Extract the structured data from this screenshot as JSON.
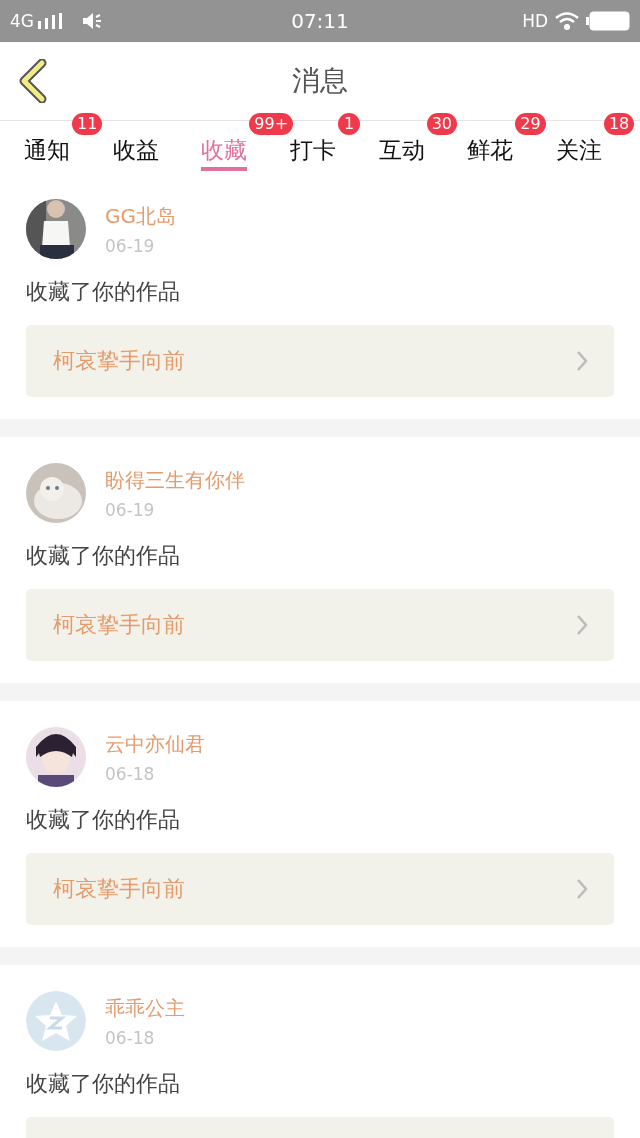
{
  "status_bar": {
    "network": "4G",
    "time": "07:11",
    "hd": "HD"
  },
  "header": {
    "title": "消息"
  },
  "tabs": [
    {
      "label": "通知",
      "badge": "11",
      "selected": false
    },
    {
      "label": "收益",
      "selected": false
    },
    {
      "label": "收藏",
      "badge": "99+",
      "selected": true
    },
    {
      "label": "打卡",
      "badge": "1",
      "selected": false
    },
    {
      "label": "互动",
      "badge": "30",
      "selected": false
    },
    {
      "label": "鲜花",
      "badge": "29",
      "selected": false
    },
    {
      "label": "关注",
      "badge": "18",
      "selected": false
    }
  ],
  "messages": [
    {
      "name": "GG北岛",
      "date": "06-19",
      "action": "收藏了你的作品",
      "work": "柯哀挚手向前"
    },
    {
      "name": "盼得三生有你伴",
      "date": "06-19",
      "action": "收藏了你的作品",
      "work": "柯哀挚手向前"
    },
    {
      "name": "云中亦仙君",
      "date": "06-18",
      "action": "收藏了你的作品",
      "work": "柯哀挚手向前"
    },
    {
      "avatar": {
        "kind": "default"
      },
      "name": "乖乖公主",
      "date": "06-18",
      "action": "收藏了你的作品"
    }
  ]
}
